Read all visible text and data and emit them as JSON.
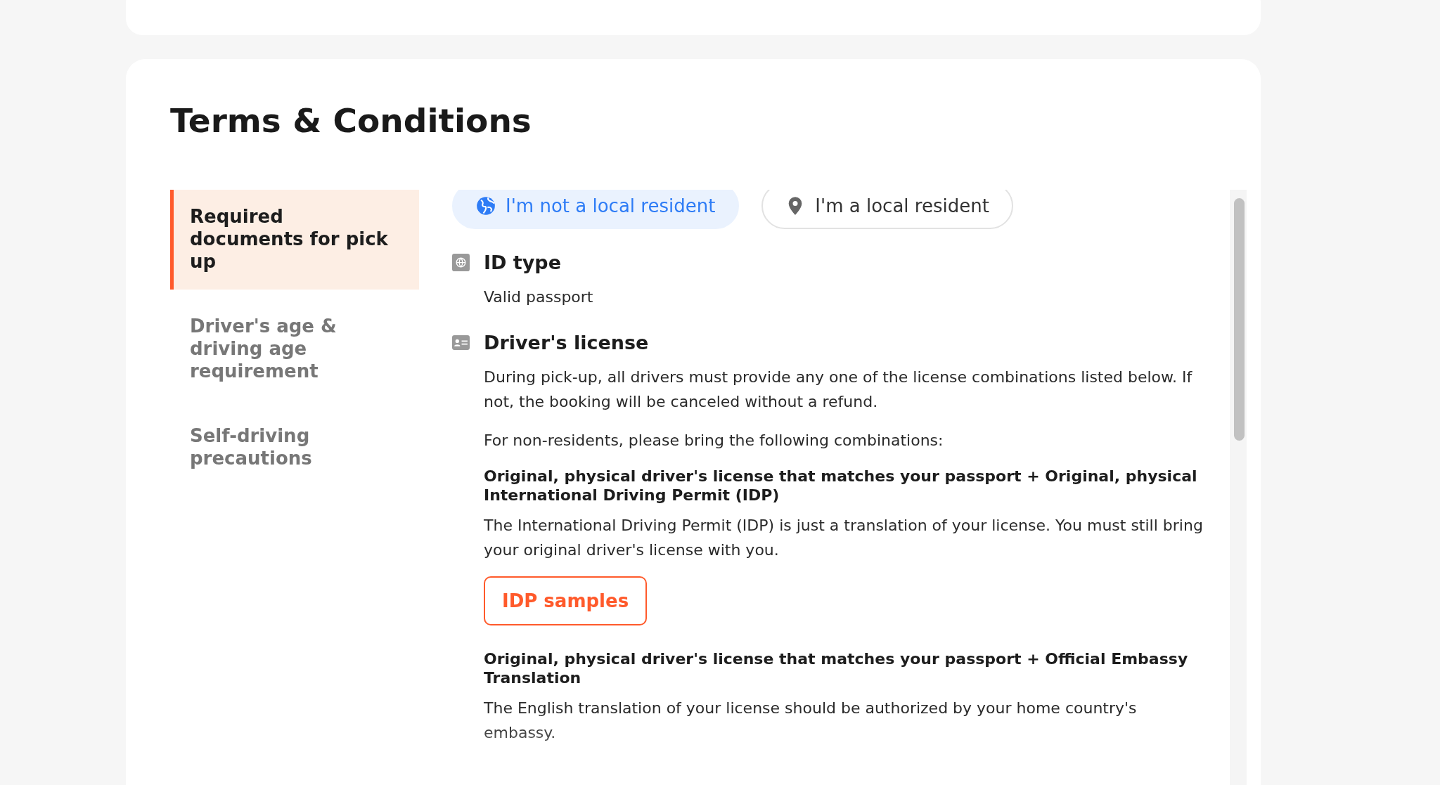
{
  "page_title": "Terms & Conditions",
  "sidebar": {
    "items": [
      {
        "label": "Required documents for pick up",
        "selected": true
      },
      {
        "label": "Driver's age & driving age requirement",
        "selected": false
      },
      {
        "label": "Self-driving precautions",
        "selected": false
      }
    ]
  },
  "resident_toggle": [
    {
      "kind": "globe",
      "label": "I'm not a local resident",
      "selected": true
    },
    {
      "kind": "pin",
      "label": "I'm a local resident",
      "selected": false
    }
  ],
  "sections": [
    {
      "kind": "id",
      "heading": "ID type",
      "blocks": [
        {
          "kind": "text",
          "text": "Valid passport"
        }
      ]
    },
    {
      "kind": "license",
      "heading": "Driver's license",
      "blocks": [
        {
          "kind": "text",
          "text": "During pick-up, all drivers must provide any one of the license combinations listed below. If not, the booking will be canceled without a refund."
        },
        {
          "kind": "text",
          "text": "For non-residents, please bring the following combinations:"
        },
        {
          "kind": "bold",
          "text": "Original, physical driver's license that matches your passport + Original, physical International Driving Permit (IDP)"
        },
        {
          "kind": "text",
          "text": "The International Driving Permit (IDP) is just a translation of your license. You must still bring your original driver's license with you."
        },
        {
          "kind": "button",
          "text": "IDP samples"
        },
        {
          "kind": "bold",
          "text": "Original, physical driver's license that matches your passport + Official Embassy Translation"
        },
        {
          "kind": "text",
          "text": "The English translation of your license should be authorized by your home country's embassy."
        }
      ]
    }
  ]
}
